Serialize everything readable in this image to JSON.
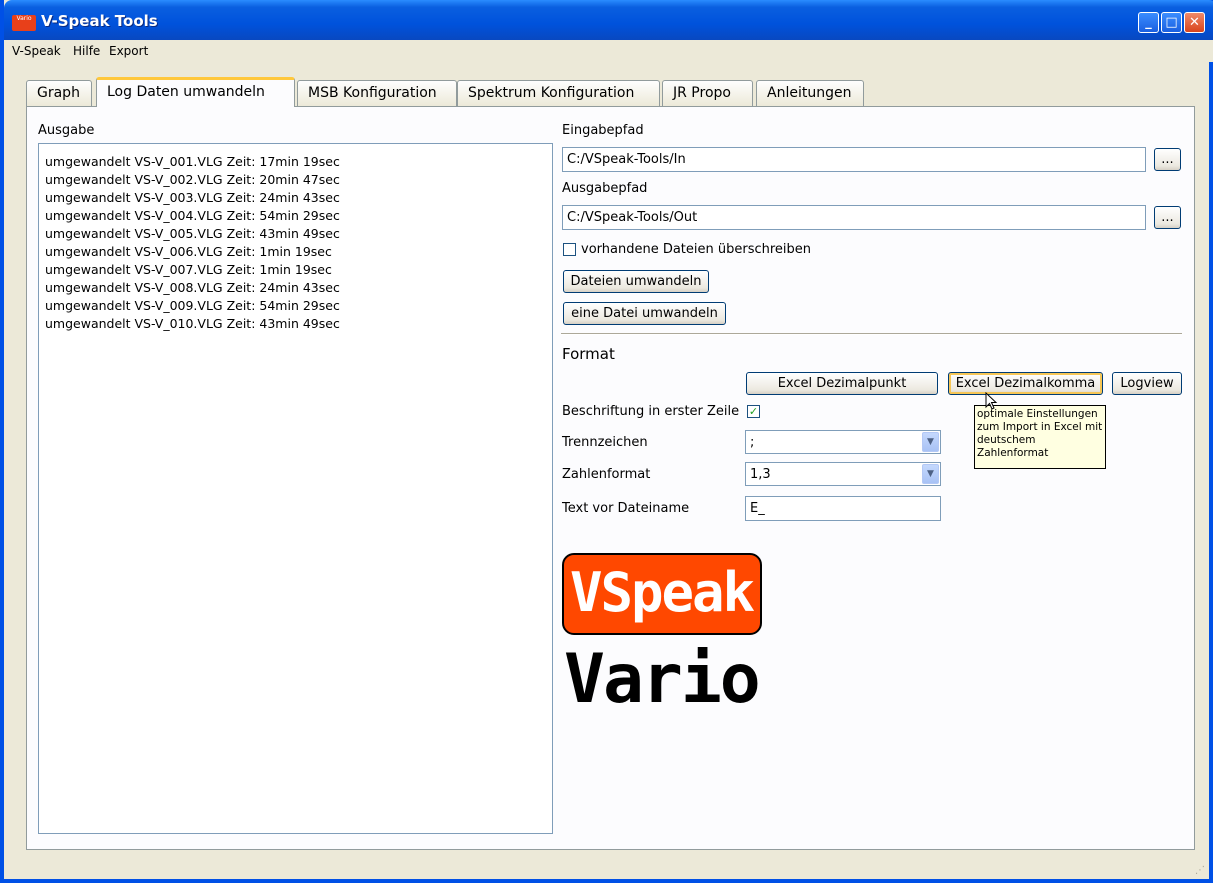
{
  "window": {
    "title": "V-Speak Tools",
    "icon_text": "Vario"
  },
  "menubar": {
    "items": [
      "V-Speak",
      "Hilfe",
      "Export"
    ]
  },
  "tabs": [
    "Graph",
    "Log Daten umwandeln",
    "MSB Konfiguration",
    "Spektrum Konfiguration",
    "JR Propo",
    "Anleitungen"
  ],
  "active_tab": "Log Daten umwandeln",
  "output": {
    "label": "Ausgabe",
    "lines": [
      "umgewandelt VS-V_001.VLG Zeit: 17min 19sec",
      "umgewandelt VS-V_002.VLG Zeit: 20min 47sec",
      "umgewandelt VS-V_003.VLG Zeit: 24min 43sec",
      "umgewandelt VS-V_004.VLG Zeit: 54min 29sec",
      "umgewandelt VS-V_005.VLG Zeit: 43min 49sec",
      "umgewandelt VS-V_006.VLG Zeit: 1min 19sec",
      "umgewandelt VS-V_007.VLG Zeit: 1min 19sec",
      "umgewandelt VS-V_008.VLG Zeit: 24min 43sec",
      "umgewandelt VS-V_009.VLG Zeit: 54min 29sec",
      "umgewandelt VS-V_010.VLG Zeit: 43min 49sec"
    ]
  },
  "input_path": {
    "label": "Eingabepfad",
    "value": "C:/VSpeak-Tools/In",
    "browse": "..."
  },
  "output_path": {
    "label": "Ausgabepfad",
    "value": "C:/VSpeak-Tools/Out",
    "browse": "..."
  },
  "overwrite": {
    "label": "vorhandene Dateien überschreiben",
    "checked": false
  },
  "buttons": {
    "convert_files": "Dateien umwandeln",
    "convert_one": "eine Datei umwandeln"
  },
  "format": {
    "heading": "Format",
    "excel_point": "Excel Dezimalpunkt",
    "excel_comma": "Excel Dezimalkomma",
    "logview": "Logview",
    "header_row_label": "Beschriftung in erster Zeile",
    "header_row_checked": true,
    "separator_label": "Trennzeichen",
    "separator_value": ";",
    "number_format_label": "Zahlenformat",
    "number_format_value": "1,3",
    "prefix_label": "Text vor Dateiname",
    "prefix_value": "E_"
  },
  "tooltip": [
    "optimale Einstellungen",
    "zum Import in Excel mit",
    "deutschem",
    "Zahlenformat"
  ],
  "logo": {
    "top": "VSpeak",
    "bottom": "Vario",
    "color": "#ff4800"
  },
  "check_mark": "✓"
}
